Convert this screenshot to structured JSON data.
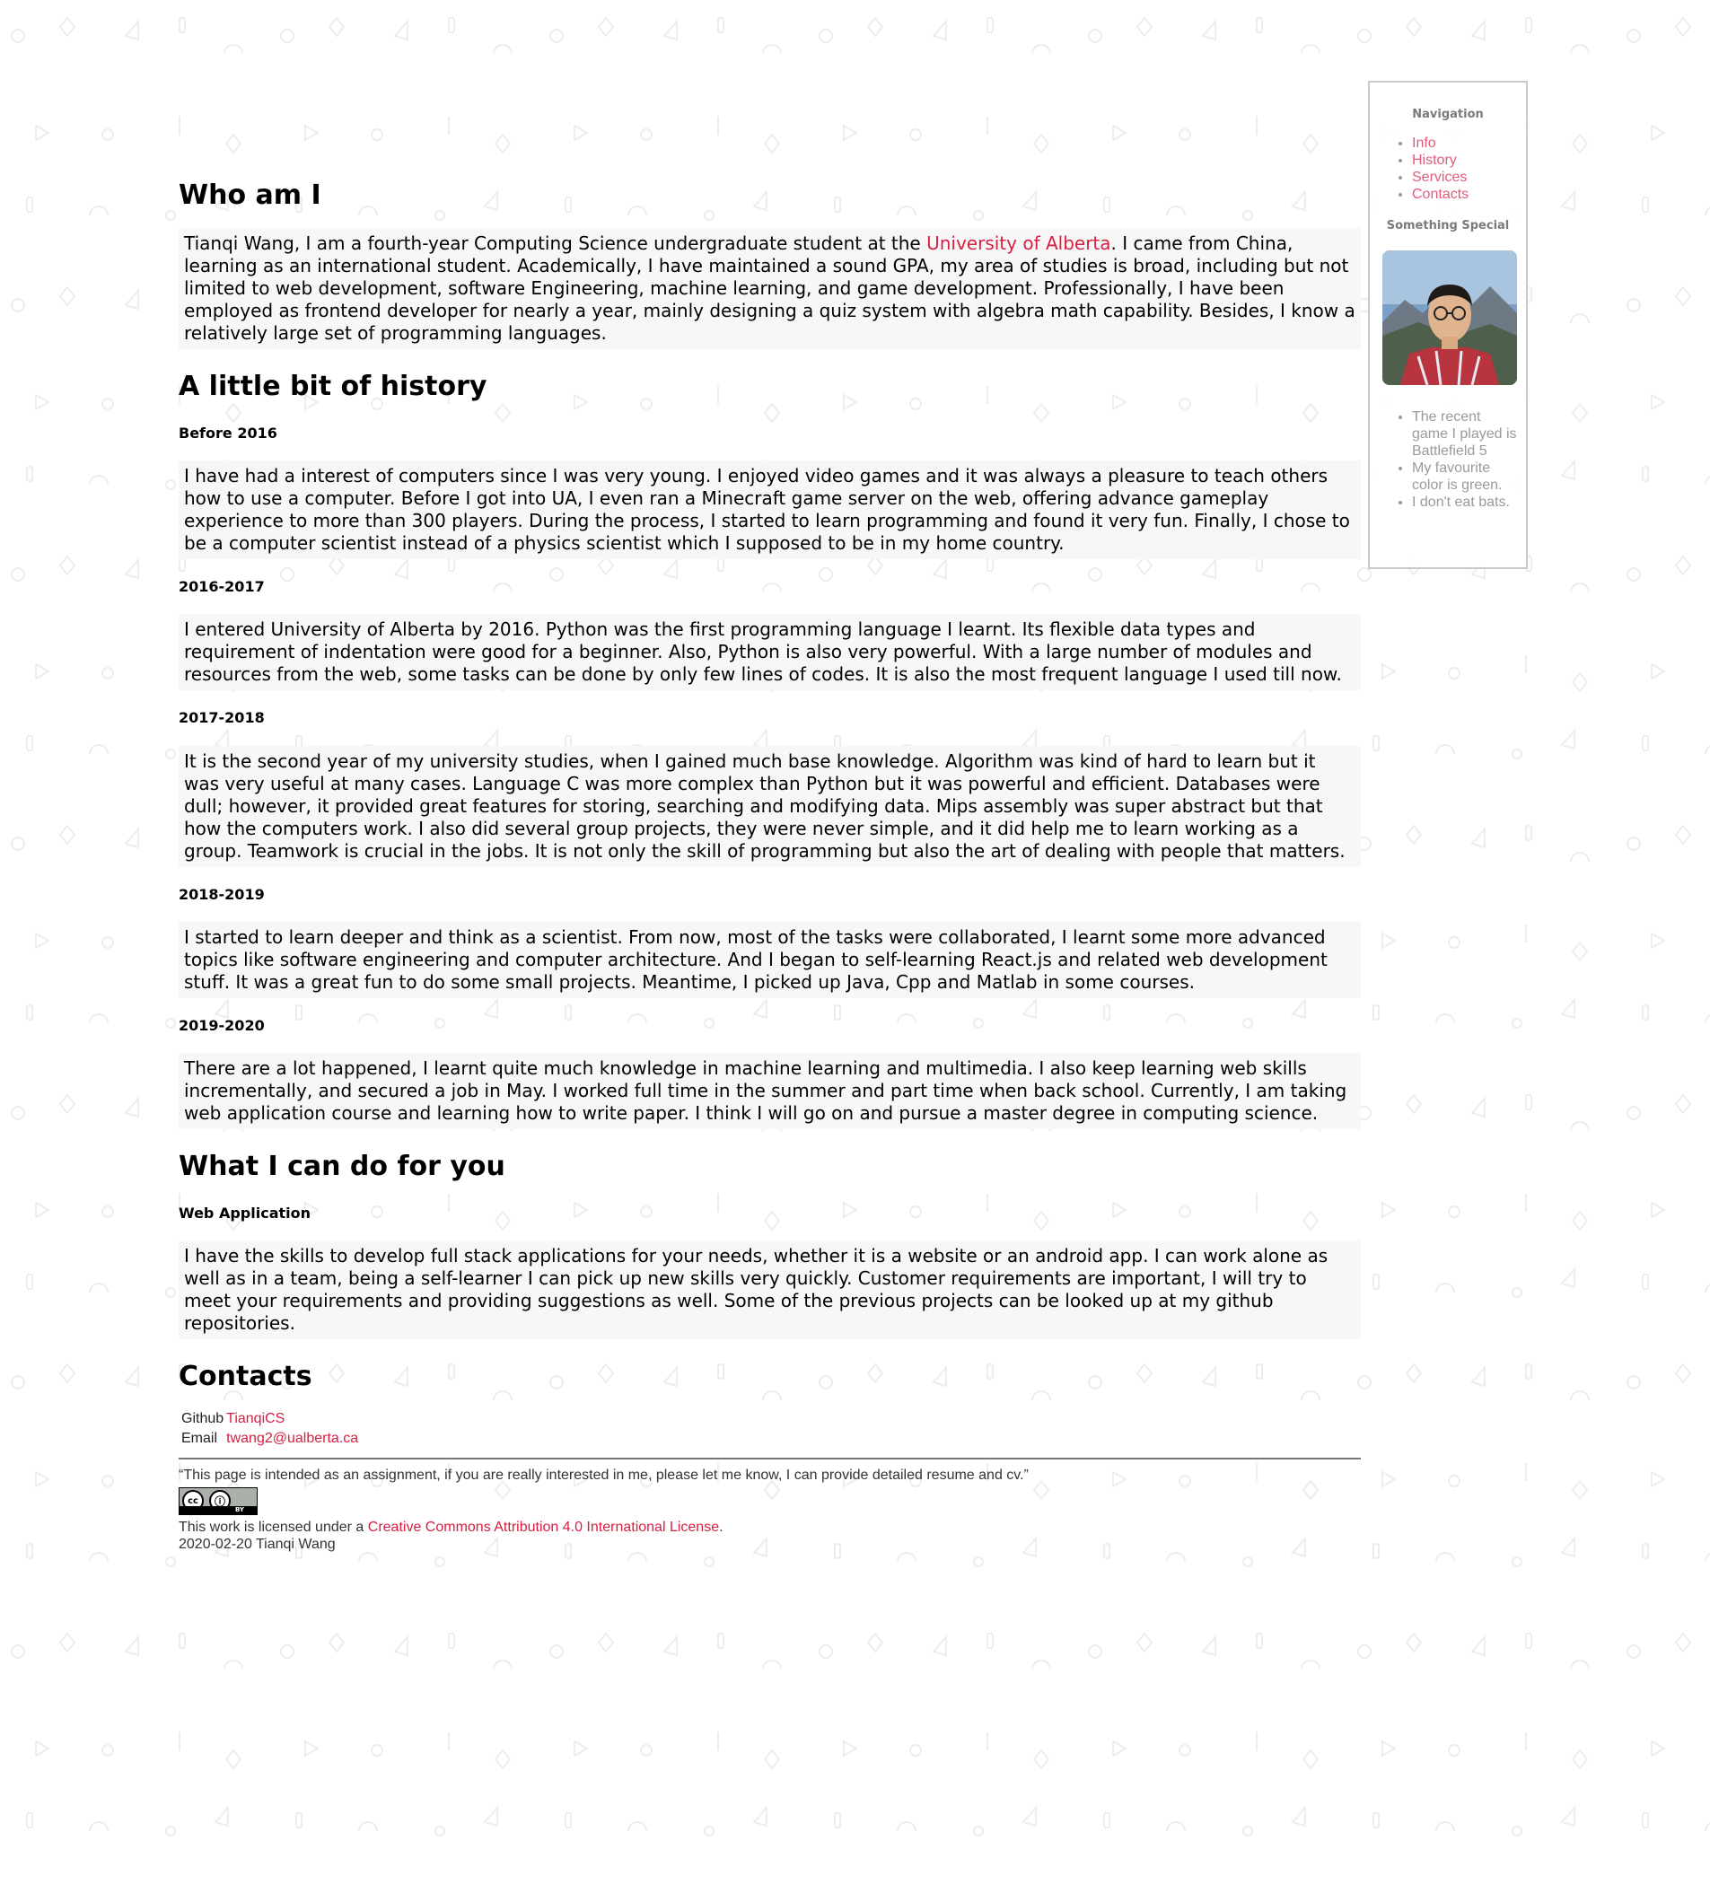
{
  "sections": {
    "who": {
      "title": "Who am I",
      "text_before": "Tianqi Wang, I am a fourth-year Computing Science undergraduate student at the ",
      "link": "University of Alberta",
      "text_after": ". I came from China, learning as an international student. Academically, I have maintained a sound GPA, my area of studies is broad, including but not limited to web development, software Engineering, machine learning, and game development. Professionally, I have been employed as frontend developer for nearly a year, mainly designing a quiz system with algebra math capability. Besides, I know a relatively large set of programming languages."
    },
    "history": {
      "title": "A little bit of history",
      "entries": [
        {
          "heading": "Before 2016",
          "text": "I have had a interest of computers since I was very young. I enjoyed video games and it was always a pleasure to teach others how to use a computer. Before I got into UA, I even ran a Minecraft game server on the web, offering advance gameplay experience to more than 300 players. During the process, I started to learn programming and found it very fun. Finally, I chose to be a computer scientist instead of a physics scientist which I supposed to be in my home country."
        },
        {
          "heading": "2016-2017",
          "text": "I entered University of Alberta by 2016. Python was the first programming language I learnt. Its flexible data types and requirement of indentation were good for a beginner. Also, Python is also very powerful. With a large number of modules and resources from the web, some tasks can be done by only few lines of codes. It is also the most frequent language I used till now."
        },
        {
          "heading": "2017-2018",
          "text": "It is the second year of my university studies, when I gained much base knowledge. Algorithm was kind of hard to learn but it was very useful at many cases. Language C was more complex than Python but it was powerful and efficient. Databases were dull; however, it provided great features for storing, searching and modifying data. Mips assembly was super abstract but that how the computers work. I also did several group projects, they were never simple, and it did help me to learn working as a group. Teamwork is crucial in the jobs. It is not only the skill of programming but also the art of dealing with people that matters."
        },
        {
          "heading": "2018-2019",
          "text": "I started to learn deeper and think as a scientist. From now, most of the tasks were collaborated, I learnt some more advanced topics like software engineering and computer architecture. And I began to self-learning React.js and related web development stuff. It was a great fun to do some small projects. Meantime, I picked up Java, Cpp and Matlab in some courses."
        },
        {
          "heading": "2019-2020",
          "text": "There are a lot happened, I learnt quite much knowledge in machine learning and multimedia. I also keep learning web skills incrementally, and secured a job in May. I worked full time in the summer and part time when back school. Currently, I am taking web application course and learning how to write paper. I think I will go on and pursue a master degree in computing science."
        }
      ]
    },
    "services": {
      "title": "What I can do for you",
      "heading": "Web Application",
      "text": "I have the skills to develop full stack applications for your needs, whether it is a website or an android app. I can work alone as well as in a team, being a self-learner I can pick up new skills very quickly. Customer requirements are important, I will try to meet your requirements and providing suggestions as well. Some of the previous projects can be looked up at my github repositories."
    },
    "contacts": {
      "title": "Contacts",
      "github_label": "Github",
      "github_value": "TianqiCS",
      "email_label": "Email",
      "email_value": "twang2@ualberta.ca"
    }
  },
  "footer": {
    "quote": "“This page is intended as an assignment, if you are really interested in me, please let me know, I can provide detailed resume and cv.”",
    "license_prefix": "This work is licensed under a ",
    "license_link": "Creative Commons Attribution 4.0 International License",
    "license_suffix": ".",
    "date_author": "2020-02-20 Tianqi Wang",
    "badge_cc": "cc",
    "badge_by": "BY"
  },
  "sidebar": {
    "nav_heading": "Navigation",
    "nav_items": [
      "Info",
      "History",
      "Services",
      "Contacts"
    ],
    "special_heading": "Something Special",
    "facts": [
      "The recent game I played is Battlefield 5",
      "My favourite color is green.",
      "I don't eat bats."
    ]
  },
  "colors": {
    "link": "#d61f42",
    "paragraph_bg": "#f7f7f7",
    "sidebar_border": "#c9c9c9"
  }
}
